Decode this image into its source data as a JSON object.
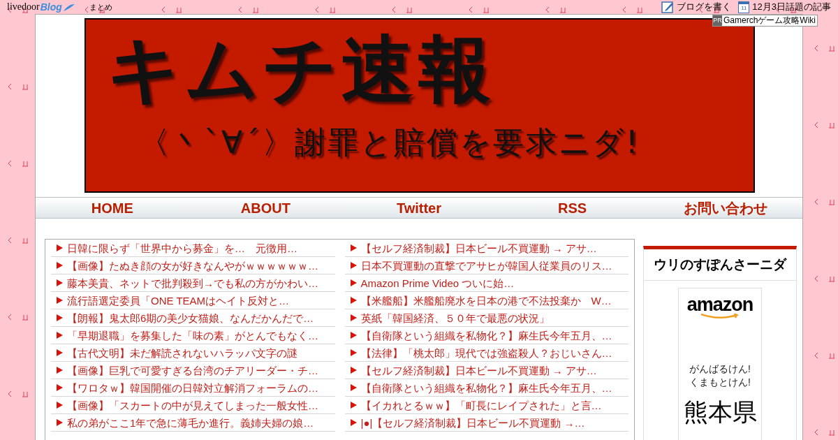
{
  "top_bar": {
    "logo": {
      "word": "livedoor",
      "blog": "Blog"
    },
    "link": "まとめ",
    "write_blog": "ブログを書く",
    "calendar_day": "11",
    "topics": "12月3日話題の記事"
  },
  "pr_ad": {
    "badge": "PR",
    "text": "Gamerchゲーム攻略Wiki"
  },
  "banner": {
    "title": "キムチ速報",
    "subtitle": "〈丶`∀´〉謝罪と賠償を要求ニダ!"
  },
  "nav": [
    "HOME",
    "ABOUT",
    "Twitter",
    "RSS",
    "お問い合わせ"
  ],
  "articles_left": [
    "日韓に限らず「世界中から募金」を…　元徴用…",
    "【画像】たぬき顔の女が好きなんやがｗｗｗｗｗｗ…",
    "藤本美貴、ネットで批判殺到→でも私の方がかわい…",
    "流行語選定委員「ONE TEAMはヘイト反対と…",
    "【朗報】鬼太郎6期の美少女猫娘、なんだかんだで…",
    "「早期退職」を募集した「味の素」がとんでもなく…",
    "【古代文明】未だ解読されないハラッパ文字の謎",
    "【画像】巨乳で可愛すぎる台湾のチアリーダー・チ…",
    "【ワロタｗ】韓国開催の日韓対立解消フォーラムの…",
    "【画像】「スカートの中が見えてしまった一般女性…",
    "私の弟がここ1年で急に薄毛か進行。義姉夫婦の娘…"
  ],
  "articles_right": [
    "【セルフ経済制裁】日本ビール不買運動 → アサ…",
    "日本不買運動の直撃でアサヒが韓国人従業員のリス…",
    "Amazon Prime Video ついに始…",
    "【米艦船】米艦船廃水を日本の港で不法投棄か　W…",
    "英紙「韓国経済、５０年で最悪の状況」",
    "【自衛隊という組織を私物化？】麻生氏今年五月、…",
    "【法律】「桃太郎」現代では強盗殺人？おじいさん…",
    "【セルフ経済制裁】日本ビール不買運動 → アサ…",
    "【自衛隊という組織を私物化？】麻生氏今年五月、…",
    "【イカれとるｗｗ】「町長にレイプされた」と言…",
    "|●|【セルフ経済制裁】日本ビール不買運動 →…"
  ],
  "sidebar": {
    "title": "ウリのすぽんさーニダ",
    "ad": {
      "brand": "amazon",
      "slogan_1": "がんばるけん!",
      "slogan_2": "くまもとけん!",
      "headline_1": "熊本県"
    }
  }
}
